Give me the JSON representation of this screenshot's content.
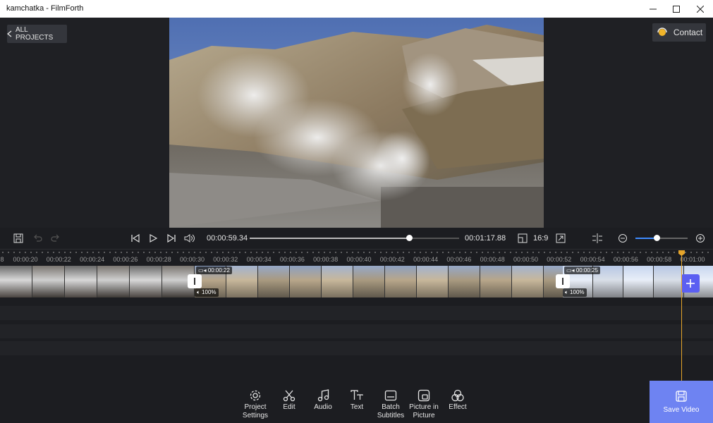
{
  "window": {
    "title": "kamchatka - FilmForth"
  },
  "header": {
    "all_projects_label": "ALL PROJECTS",
    "contact_label": "Contact"
  },
  "playback": {
    "current_time": "00:00:59.34",
    "total_time": "00:01:17.88",
    "progress": 0.76,
    "aspect_ratio": "16:9",
    "zoom_level": 0.4
  },
  "timeline": {
    "ruler_labels": [
      "8",
      "00:00:20",
      "00:00:22",
      "00:00:24",
      "00:00:26",
      "00:00:28",
      "00:00:30",
      "00:00:32",
      "00:00:34",
      "00:00:36",
      "00:00:38",
      "00:00:40",
      "00:00:42",
      "00:00:44",
      "00:00:46",
      "00:00:48",
      "00:00:50",
      "00:00:52",
      "00:00:54",
      "00:00:56",
      "00:00:58",
      "00:01:00"
    ],
    "clips": [
      {
        "duration_label": "",
        "volume_label": ""
      },
      {
        "duration_label": "00:00:22",
        "volume_label": "100%"
      },
      {
        "duration_label": "00:00:25",
        "volume_label": "100%"
      }
    ]
  },
  "toolbar": {
    "items": [
      {
        "label": "Project Settings",
        "icon": "gear-icon"
      },
      {
        "label": "Edit",
        "icon": "scissors-icon"
      },
      {
        "label": "Audio",
        "icon": "music-note-icon"
      },
      {
        "label": "Text",
        "icon": "text-icon"
      },
      {
        "label": "Batch Subtitles",
        "icon": "subtitles-icon"
      },
      {
        "label": "Picture in Picture",
        "icon": "picture-in-picture-icon"
      },
      {
        "label": "Effect",
        "icon": "effect-icon"
      }
    ],
    "save_video_label": "Save Video"
  },
  "colors": {
    "accent": "#6e83f2",
    "playhead": "#e6a52a",
    "zoom_fill": "#3f8cff"
  }
}
